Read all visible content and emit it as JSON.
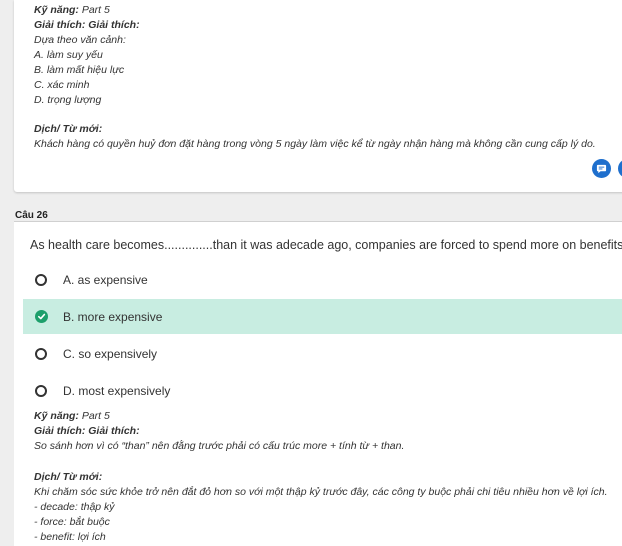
{
  "prev_explanation": {
    "skill_label": "Kỹ năng:",
    "skill_value": "Part 5",
    "explain_label": "Giải thích: Giải thích:",
    "lines": [
      "Dựa theo văn cảnh:",
      "A. làm suy yếu",
      "B. làm mất hiệu lực",
      "C. xác minh",
      "D. trọng lượng"
    ],
    "translation_label": "Dịch/ Từ mới:",
    "translation_text": "Khách hàng có quyền huỷ đơn đặt hàng trong vòng 5 ngày làm việc kể từ ngày nhận hàng mà không cần cung cấp lý do."
  },
  "question": {
    "label": "Câu 26",
    "text": "As health care becomes..............than it was adecade ago, companies are forced to spend more on benefits.",
    "options": [
      {
        "label": "A. as expensive",
        "selected": false
      },
      {
        "label": "B. more expensive",
        "selected": true
      },
      {
        "label": "C. so expensively",
        "selected": false
      },
      {
        "label": "D. most expensively",
        "selected": false
      }
    ]
  },
  "explanation": {
    "skill_label": "Kỹ năng:",
    "skill_value": "Part 5",
    "explain_label": "Giải thích: Giải thích:",
    "explain_text": "So sánh hơn vì có “than” nên đằng trước phải có cấu trúc more + tính từ + than.",
    "translation_label": "Dịch/ Từ mới:",
    "translation_text": "Khi chăm sóc sức khỏe trở nên đắt đỏ hơn so với một thập kỷ trước đây, các công ty buộc phải chi tiêu nhiều hơn về lợi ích.",
    "vocab": [
      "- decade: thập kỷ",
      "- force: bắt buộc",
      "- benefit: lợi ích"
    ]
  },
  "colors": {
    "selected_bg": "#c8ede1",
    "check_green": "#1d9f6b",
    "action_blue": "#1e6fcd"
  },
  "icons": [
    "comment-icon",
    "check-icon"
  ]
}
